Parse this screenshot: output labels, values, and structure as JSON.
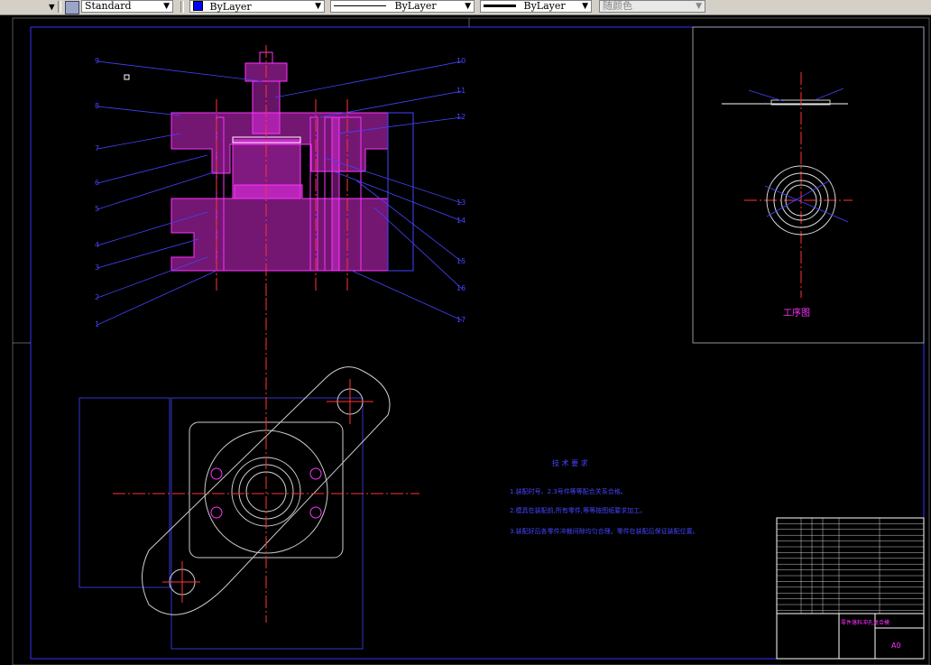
{
  "toolbar": {
    "text_style": "Standard",
    "layer_color": "ByLayer",
    "linetype": "ByLayer",
    "lineweight": "ByLayer",
    "plot_style": "随颜色"
  },
  "drawing": {
    "part_numbers_left": [
      "9",
      "8",
      "7",
      "6",
      "5",
      "4",
      "3",
      "2",
      "1"
    ],
    "part_numbers_right": [
      "10",
      "11",
      "12",
      "13",
      "14",
      "15",
      "16",
      "17"
    ],
    "process_label": "工序图",
    "tech_title": "技 术 要 求",
    "tech_notes": [
      "1.装配时号、2.3号件等等配合关系合格。",
      "2.模具在装配前,所有零件,等等按图纸要求加工。",
      "3.装配好后各零件冲裁间隙均匀合理。零件在装配后保证装配位置。"
    ],
    "title_block_name": "零件落料冲孔复合模",
    "sheet_size": "A0"
  }
}
